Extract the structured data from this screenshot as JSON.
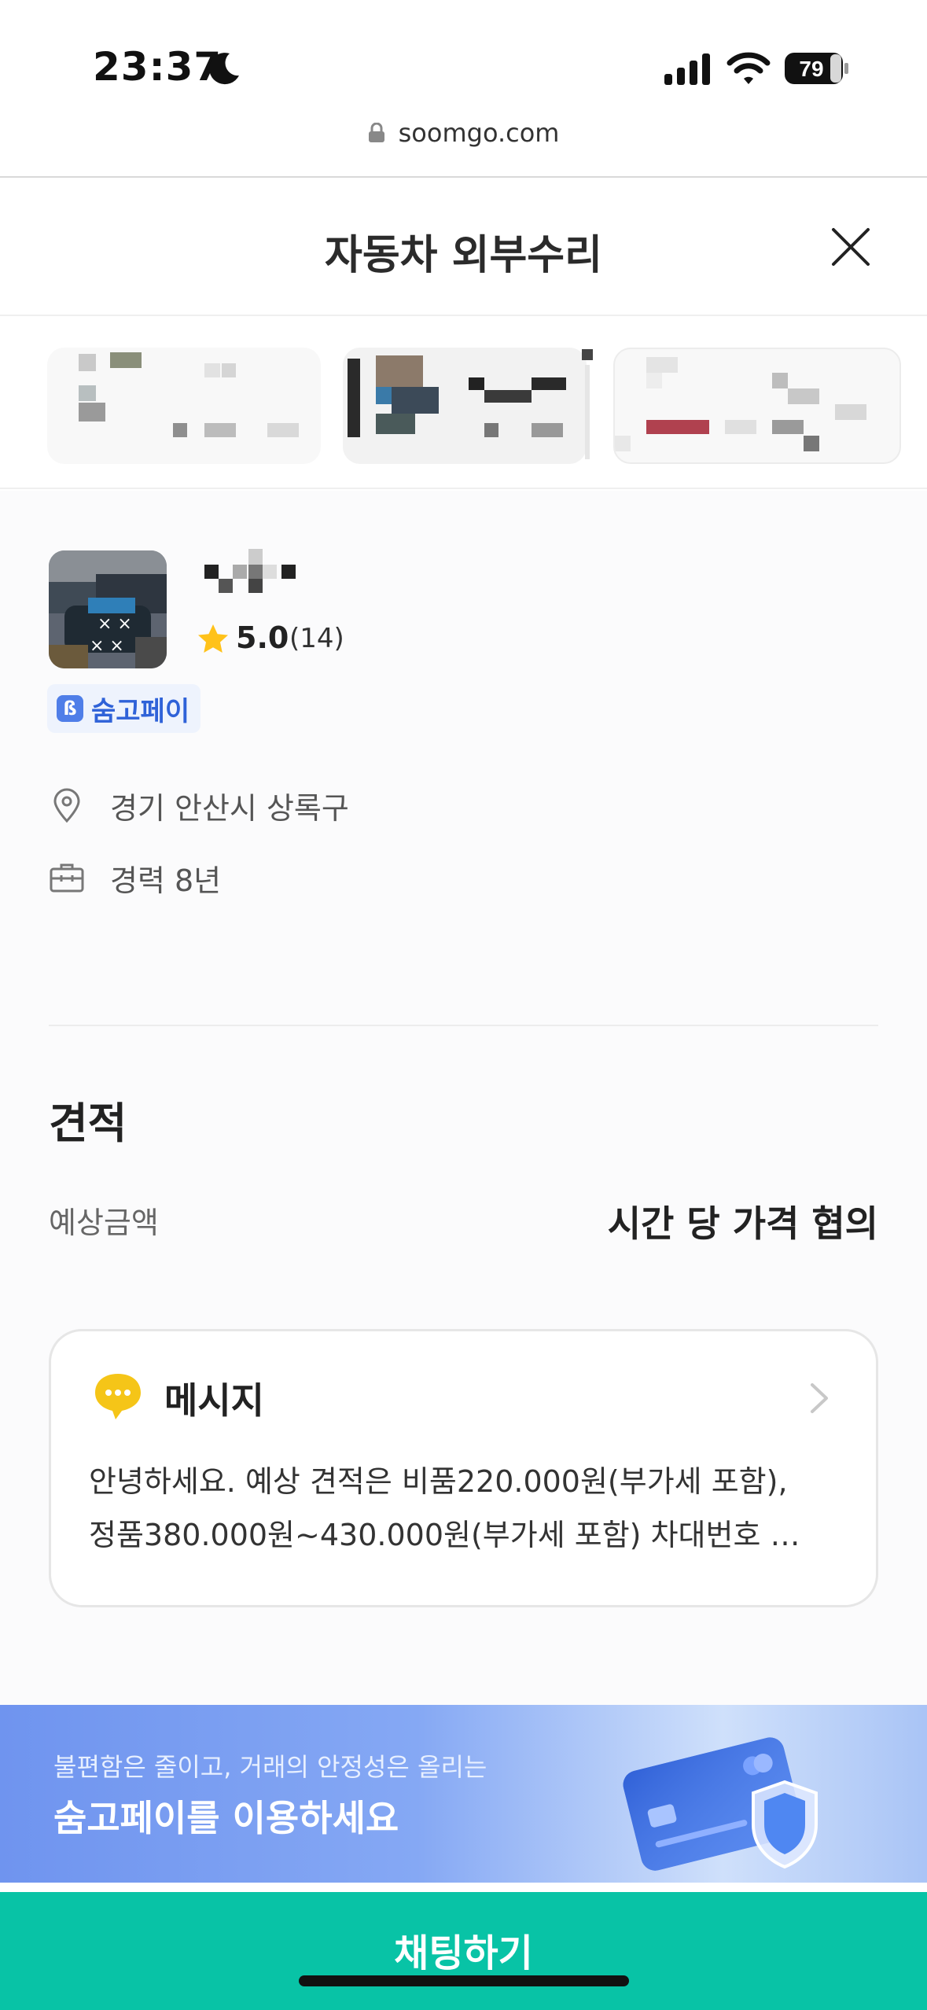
{
  "status_bar": {
    "time": "23:37",
    "battery": "79",
    "icons": [
      "moon-icon",
      "signal-icon",
      "wifi-icon",
      "battery-icon"
    ]
  },
  "browser": {
    "url": "soomgo.com"
  },
  "header": {
    "title": "자동차 외부수리",
    "close_icon": "close-icon"
  },
  "pro": {
    "rating": "5.0",
    "review_count": "(14)",
    "pay_badge_label": "숨고페이",
    "location": "경기 안산시 상록구",
    "experience": "경력 8년"
  },
  "estimate": {
    "section_title": "견적",
    "label": "예상금액",
    "value": "시간 당 가격 협의"
  },
  "message": {
    "title": "메시지",
    "line1": "안녕하세요. 예상 견적은 비품220.000원(부가세 포함),",
    "line2": "정품380.000원~430.000원(부가세 포함) 차대번호 …"
  },
  "banner": {
    "subtitle": "불편함은 줄이고, 거래의 안정성은 올리는",
    "title": "숨고페이를 이용하세요"
  },
  "cta": {
    "label": "채팅하기"
  },
  "colors": {
    "primary": "#08c3a6",
    "pay_blue": "#2f62d8",
    "star": "#ffc21a",
    "message_icon": "#f5c518"
  }
}
